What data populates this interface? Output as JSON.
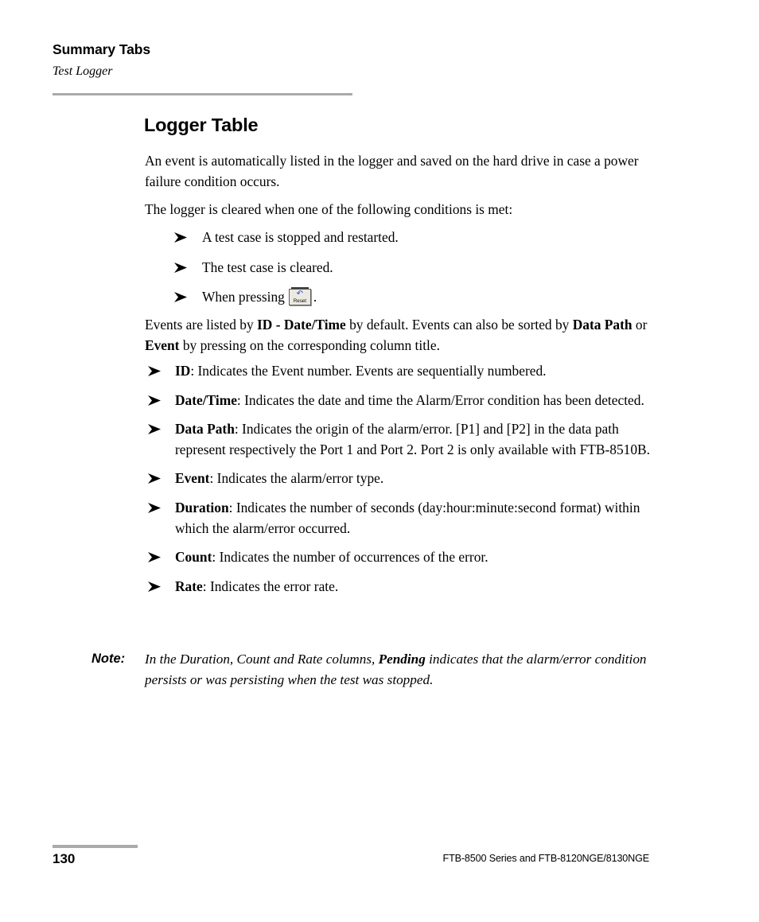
{
  "header": {
    "title": "Summary Tabs",
    "subtitle": "Test Logger"
  },
  "section": {
    "title": "Logger Table",
    "intro_paragraph": "An event is automatically listed in the logger and saved on the hard drive in case a power failure condition occurs.",
    "cleared_lead_in": "The logger is cleared when one of the following conditions is met:"
  },
  "conditions": [
    {
      "text": "A test case is stopped and restarted."
    },
    {
      "text": "The test case is cleared."
    },
    {
      "prefix": "When pressing",
      "button": {
        "label": "Reset",
        "icon": "undo-arrow-icon",
        "icon_color": "#2a47b8"
      },
      "suffix": "."
    }
  ],
  "sorting_paragraph": {
    "part1": "Events are listed by ",
    "bold1": "ID - Date/Time",
    "part2": " by default. Events can also be sorted by ",
    "bold2": "Data Path",
    "part3": " or ",
    "bold3": "Event",
    "part4": " by pressing on the corresponding column title."
  },
  "column_definitions": [
    {
      "term": "ID",
      "description": ": Indicates the Event number. Events are sequentially numbered."
    },
    {
      "term": "Date/Time",
      "description": ": Indicates the date and time the Alarm/Error condition has been detected."
    },
    {
      "term": "Data Path",
      "description": ": Indicates the origin of the alarm/error. [P1] and [P2] in the data path represent respectively the Port 1 and Port 2. Port 2 is only available with FTB-8510B."
    },
    {
      "term": "Event",
      "description": ": Indicates the alarm/error type."
    },
    {
      "term": "Duration",
      "description": ": Indicates the number of seconds (day:hour:minute:second format) within which the alarm/error occurred."
    },
    {
      "term": "Count",
      "description": ": Indicates the number of occurrences of the error."
    },
    {
      "term": "Rate",
      "description": ": Indicates the error rate."
    }
  ],
  "note": {
    "label": "Note:",
    "part1": "In the Duration, Count and Rate columns, ",
    "bold": "Pending",
    "part2": " indicates that the alarm/error condition persists or was persisting when the test was stopped."
  },
  "footer": {
    "page_number": "130",
    "product": "FTB-8500 Series and FTB-8120NGE/8130NGE"
  },
  "colors": {
    "rule": "#aaaaaa",
    "text": "#000000",
    "button_face": "#ece9e0",
    "button_icon": "#2a47b8"
  }
}
